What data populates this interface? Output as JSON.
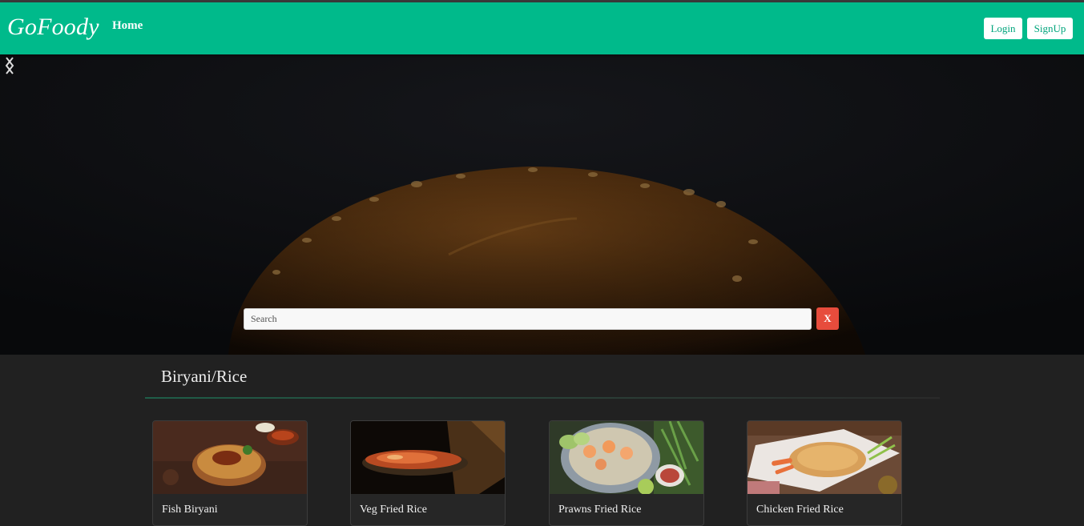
{
  "navbar": {
    "brand": "GoFoody",
    "home_label": "Home",
    "login_label": "Login",
    "signup_label": "SignUp",
    "background_color": "#00ba8b"
  },
  "hero": {
    "search_placeholder": "Search",
    "clear_label": "X",
    "clear_button_color": "#e74c3c",
    "prev_icon": "chevron-left-icon",
    "next_icon": "chevron-right-icon"
  },
  "category": {
    "title": "Biryani/Rice",
    "items": [
      {
        "name": "Fish Biryani"
      },
      {
        "name": "Veg Fried Rice"
      },
      {
        "name": "Prawns Fried Rice"
      },
      {
        "name": "Chicken Fried Rice"
      }
    ]
  }
}
